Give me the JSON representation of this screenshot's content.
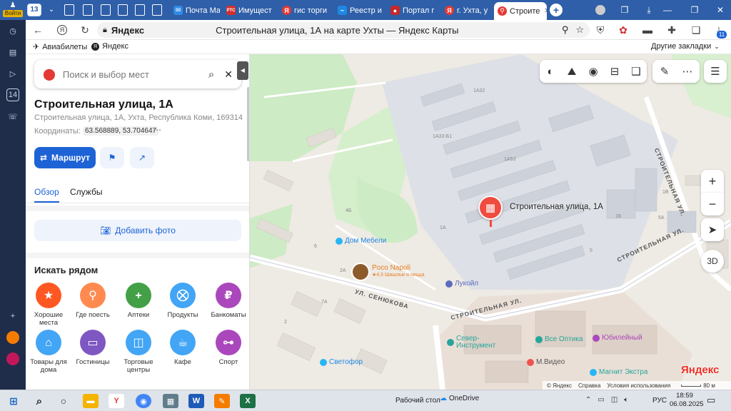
{
  "browser": {
    "ya_button": "Войти",
    "tab_count": "13",
    "tabs": [
      {
        "label": "Почта Ма",
        "color": "#2f8ae5",
        "glyph": "✉"
      },
      {
        "label": "Имущест",
        "color": "#d32f2f",
        "glyph": "РТС"
      },
      {
        "label": "гис торги",
        "color": "#e53935",
        "glyph": "Я"
      },
      {
        "label": "Реестр и",
        "color": "#1e88e5",
        "glyph": "~"
      },
      {
        "label": "Портал г",
        "color": "#c62828",
        "glyph": "●"
      },
      {
        "label": "г. Ухта, у",
        "color": "#e53935",
        "glyph": "Я"
      },
      {
        "label": "Строите",
        "color": "#e53935",
        "glyph": "⚲"
      }
    ],
    "address_site": "Яндекс",
    "page_title": "Строительная улица, 1А на карте Ухты — Яндекс Карты",
    "ext_badge": "11",
    "bookmarks": [
      {
        "label": "Авиабилеты",
        "icon": "plane-icon"
      },
      {
        "label": "Яндекс",
        "icon": "yandex-icon"
      }
    ],
    "other_bookmarks": "Другие закладки"
  },
  "sidebar_strip": {
    "badge": "14"
  },
  "panel": {
    "search_placeholder": "Поиск и выбор мест",
    "title": "Строительная улица, 1А",
    "address": "Строительная улица, 1А, Ухта, Республика Коми, 169314",
    "coords_label": "Координаты:",
    "coords_value": "63.568889, 53.704647",
    "route_label": "Маршрут",
    "tabs": [
      "Обзор",
      "Службы"
    ],
    "add_photo": "Добавить фото",
    "nearby_title": "Искать рядом",
    "categories": [
      {
        "label": "Хорошие места",
        "color": "#ff5722",
        "glyph": "★"
      },
      {
        "label": "Где поесть",
        "color": "#ff8a50",
        "glyph": "⚲"
      },
      {
        "label": "Аптеки",
        "color": "#43a047",
        "glyph": "+"
      },
      {
        "label": "Продукты",
        "color": "#42a5f5",
        "glyph": "⛒"
      },
      {
        "label": "Банкоматы",
        "color": "#ab47bc",
        "glyph": "₽"
      },
      {
        "label": "Товары для дома",
        "color": "#42a5f5",
        "glyph": "⌂"
      },
      {
        "label": "Гостиницы",
        "color": "#7e57c2",
        "glyph": "▭"
      },
      {
        "label": "Торговые центры",
        "color": "#42a5f5",
        "glyph": "◫"
      },
      {
        "label": "Кафе",
        "color": "#42a5f5",
        "glyph": "☕"
      },
      {
        "label": "Спорт",
        "color": "#ab47bc",
        "glyph": "⊶"
      }
    ]
  },
  "map": {
    "pin_label": "Строительная улица, 1А",
    "house_numbers": [
      "1А32",
      "1А33-Б1",
      "1А53",
      "1В",
      "4Б",
      "2А",
      "1А",
      "5А",
      "1Б",
      "6",
      "2",
      "7А",
      "5"
    ],
    "streets": [
      "СТРОИТЕЛЬНАЯ УЛ.",
      "УЛ. СЕНЮКОВА",
      "СТРОИТЕЛЬНАЯ УЛ.",
      "СТРОИТЕЛЬНАЯ УЛ."
    ],
    "pois": [
      {
        "name": "Дом Мебели",
        "color": "#29b6f6"
      },
      {
        "name": "Poco Napoli",
        "sub": "★4,5 Шашлык и пицца",
        "color": "#e67e22"
      },
      {
        "name": "Лукойл",
        "color": "#5c6bc0"
      },
      {
        "name": "Север-Инструмент",
        "color": "#26a69a"
      },
      {
        "name": "Все Оптика",
        "color": "#26a69a"
      },
      {
        "name": "Юбилейный",
        "color": "#ab47bc"
      },
      {
        "name": "Светофор",
        "color": "#29b6f6"
      },
      {
        "name": "М.Видео",
        "color": "#ef5350"
      },
      {
        "name": "Магнит Экстра",
        "color": "#29b6f6"
      }
    ],
    "btn_3d": "3D",
    "logo": "Яндекс",
    "scale": "80 м",
    "footer": [
      "© Яндекс",
      "Справка",
      "Условия использования"
    ]
  },
  "taskbar": {
    "desktop_label": "Рабочий стол",
    "onedrive": "OneDrive",
    "lang": "РУС",
    "time": "18:59",
    "date": "06.08.2025"
  }
}
